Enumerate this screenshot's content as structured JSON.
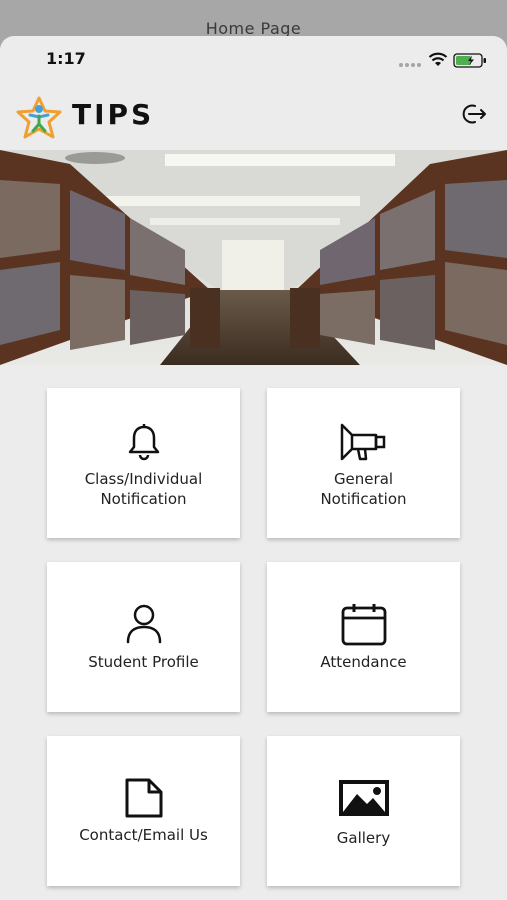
{
  "window": {
    "title": "Home Page"
  },
  "status_bar": {
    "time": "1:17"
  },
  "header": {
    "app_name": "TIPS",
    "logo_icon": "star-person-logo",
    "logout_icon": "logout-icon"
  },
  "banner": {
    "image": "library-bookshelves-photo"
  },
  "menu": [
    {
      "line1": "Class/Individual",
      "line2": "Notification",
      "icon": "bell-icon"
    },
    {
      "line1": "General",
      "line2": "Notification",
      "icon": "megaphone-icon"
    },
    {
      "line1": "Student Profile",
      "icon": "person-icon"
    },
    {
      "line1": "Attendance",
      "icon": "calendar-icon"
    },
    {
      "line1": "Contact/Email Us",
      "icon": "document-icon"
    },
    {
      "line1": "Gallery",
      "icon": "image-icon"
    }
  ],
  "colors": {
    "background": "#ececec",
    "card": "#ffffff",
    "battery": "#4caf50",
    "logo_star": "#f0a030",
    "logo_person": "#4a9fd5"
  }
}
